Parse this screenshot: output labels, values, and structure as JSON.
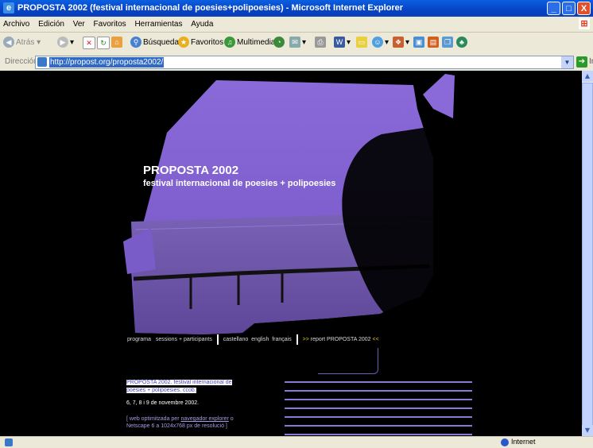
{
  "window": {
    "title": "PROPOSTA 2002 (festival internacional de poesies+polipoesies) - Microsoft Internet Explorer",
    "minimize": "_",
    "maximize": "□",
    "close": "X"
  },
  "menu": [
    "Archivo",
    "Edición",
    "Ver",
    "Favoritos",
    "Herramientas",
    "Ayuda"
  ],
  "toolbar": {
    "back": "Atrás",
    "search": "Búsqueda",
    "favorites": "Favoritos",
    "media": "Multimedia"
  },
  "address": {
    "label": "Dirección",
    "url": "http://propost.org/proposta2002/",
    "go_label": "Ir"
  },
  "page": {
    "title": "PROPOSTA 2002",
    "subtitle": "festival internacional de poesies + polipoesies",
    "nav": {
      "programa": "programa",
      "sessions": "sessions + participants",
      "castellano": "castellano",
      "english": "english",
      "francais": "français",
      "report_prefix": ">>",
      "report": "report PROPOSTA 2002",
      "report_suffix": "<<"
    },
    "info": {
      "line1": "PROPOSTA 2002. festival internacional de",
      "line2": "poesies + polipoesies. ccob.",
      "dates": "6, 7, 8 i 9 de novembre 2002.",
      "note_a": "[ web optimitzada per",
      "note_link": "navegador explorer",
      "note_b": "o Netscape 6 a 1024x768 px de resolució ]"
    }
  },
  "status": {
    "zone": "Internet"
  },
  "colors": {
    "photo_purple": "#7a5cc8",
    "accent_yellow": "#e8c020",
    "titlebar_blue": "#0a5fe0"
  }
}
